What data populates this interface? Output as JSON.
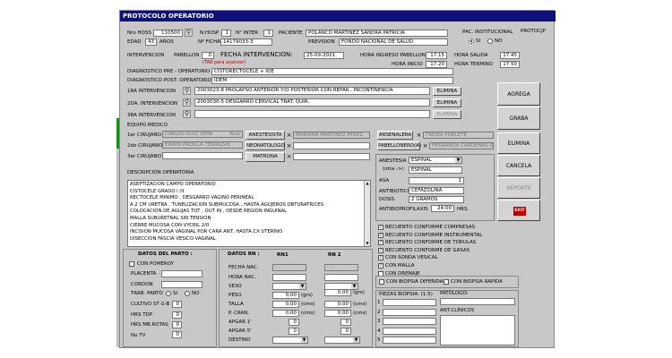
{
  "window": {
    "title": "PROTOCOLO OPERATORIO"
  },
  "header": {
    "nro_hoss_label": "Nro HOSS",
    "nro_hoss": "110500",
    "n_hosp_label": "N.HOSP",
    "n_hosp": "1",
    "n_inter_label": "N° INTER",
    "n_inter": "1",
    "paciente_label": "PACIENTE",
    "paciente": "POLANCO MARTINEZ SANDRA PATRICIA",
    "pac_inst_label": "PAC. INSTITUCIONAL",
    "protocjp_label": "PROTOCJP",
    "edad_label": "EDAD",
    "edad": "43",
    "anos_label": "AÑOS",
    "ficha_label": "Nº FICHA",
    "ficha": "14179033-3",
    "prevision_label": "PREVISION",
    "prevision": "FONDO NACIONAL DE SALUD",
    "si_label": "SI",
    "no_label": "NO"
  },
  "intervencion": {
    "label": "INTERVENCION",
    "pabellon_label": "PABELLON",
    "pabellon": "0",
    "tab_hint": "(TAB para avanzar)",
    "fecha_label": "FECHA INTERVENCION:",
    "fecha": "25-09-2021",
    "hora_ingreso_label": "HORA INGRESO PABELLON",
    "hora_ingreso": "17.15",
    "hora_salida_label": "HORA SALIDA",
    "hora_salida": "17.45",
    "hora_inicio_label": "HORA INICIO",
    "hora_inicio": "17.20",
    "hora_termino_label": "HORA TERMINO",
    "hora_termino": "17.50",
    "dx_pre_label": "DIAGNOSTICO PRE - OPERATORIO",
    "dx_pre": "CISTORECTOCELE + IOE",
    "dx_post_label": "DIAGNOSTICO POST- OPERATORIO",
    "dx_post": "IDEM",
    "int1_label": "1RA INTERVENCION",
    "int1": "2003023-8  PROLAPSO ANTERIOR Y/O POSTERIOR CON REPAR.. INCONTINENCIA",
    "int2_label": "2DA. INTERVENCION",
    "int2": "2003030-5  DESGARRO CERVICAL TRAT. QUIR.",
    "int3_label": "3RA INTERVENCION",
    "elimina_label": "ELIMINA"
  },
  "equipo": {
    "label": "EQUIPO MEDICO",
    "c1_label": "1er CIRUJANO",
    "c1": "CARLOS RUIZ VERA",
    "c1_code": "Ruiz",
    "c2_label": "2do CIRUJANO",
    "c2": "ERWIN PADILLA TERRAZAS",
    "c3_label": "3er CIRUJANO",
    "anestesista_label": "ANESTESISTA",
    "anestesista": "MARIANA MARTINEZ PEREZ",
    "neonatologo_label": "NEONATOLOGO",
    "matrona_label": "MATRONA",
    "arsenalera_label": "ARSENALERA",
    "arsenalera": "TRESIA POBLETE",
    "pabellonera_label": "PABELLONERO(A)",
    "pabellonera": "FERNANDA CARDENAS GA"
  },
  "buttons": {
    "agrega": "AGREGA",
    "graba": "GRABA",
    "elimina": "ELIMINA",
    "cancela": "CANCELA",
    "reporte": "REPORTE",
    "exit": "EXIT"
  },
  "descripcion": {
    "label": "DESCRIPCIÓN OPERATORIA",
    "lines": [
      "ASEPTIZACION  CAMPO OPERATORIO",
      "CISTOCELE GRADO I /II",
      "RECTOCELE MINIMO , DESGARRO VAGINO PERINEAL",
      "A 2 CM URETRA , TUNELIZACION SUBMUCOSA , HASTA AGUJEROS OBTURATRICES",
      "COLOCACION DE AGUJAS TOT , OUT IN , DESDE REGION INGUINAL",
      "MALLA SUBURETRAL SIN TENSION",
      "CIERRE MUCOSA  CON VYCRIL 2/0",
      "INCISION MUCOSA VAGINAL POR CARA ANT, HASTA CX UTERINO",
      "DISECCION FASCIA  VESICO VAGINAL"
    ]
  },
  "anestesia": {
    "label": "ANESTESIA",
    "otra_label": "(otra ->)",
    "tipo": "ESPINAL",
    "tipo2": "ESPINAL",
    "asa_label": "ASA",
    "asa": "1",
    "antibiotico_label": "ANTIBIOTICO",
    "antibiotico": "CEFAZOLINA",
    "dosis_label": "DOSIS",
    "dosis": "2 GRAMOS",
    "profilaxis_label": "ANTIBIOPROFILAXIS",
    "profilaxis": "24:00",
    "hrs_label": "HRS."
  },
  "checks": [
    {
      "label": "RECUENTO CONFORME COMPRESAS",
      "checked": true
    },
    {
      "label": "RECUENTO CONFORME INSTRUMENTAL",
      "checked": true
    },
    {
      "label": "RECUENTO CONFORME DE TORULAS",
      "checked": true
    },
    {
      "label": "RECUENTO CONFORME DE GASAS",
      "checked": true
    },
    {
      "label": "CON SONDA VESICAL",
      "checked": true
    },
    {
      "label": "CON MALLA",
      "checked": true
    },
    {
      "label": "CON DRENAJE",
      "checked": false
    }
  ],
  "parto": {
    "label": "DATOS DEL PARTO :",
    "pomeroy": "CON POMEROY",
    "placenta": "PLACENTA",
    "cordon": "CORDON",
    "trab_parto": "TRAB. PARTO",
    "si": "SI",
    "no": "NO",
    "cultivo": "CULTIVO ST G-B",
    "hrs_tdp": "HRS TDP",
    "hrs_mb": "HRS MB.ROTAS",
    "no_tv": "No TV",
    "cultivo_val": "0",
    "hrs_tdp_val": "0",
    "hrs_mb_val": "0",
    "no_tv_val": "0"
  },
  "rn": {
    "label": "DATOS RN :",
    "rn1": "RN1",
    "rn2": "RN 2",
    "fields": [
      "FECHA NAC.",
      "HORA NAC.",
      "SEXO",
      "PESO",
      "TALLA",
      "P. CRAN.",
      "APGAR 1'",
      "APGAR 5'",
      "DESTINO"
    ],
    "date_ph": "-  -",
    "peso1": "0,00",
    "peso2": "0,00",
    "talla1": "0,00",
    "talla2": "0,00",
    "pcran1": "0,00",
    "pcran2": "0,00",
    "apgar1_1": "0",
    "apgar5_1": "0",
    "apgar1_2": "0",
    "apgar5_2": "0",
    "grs": "(grs)",
    "cms": "(cms)"
  },
  "biopsia": {
    "diferida": "CON BIOPSIA DIFERIDA",
    "rapida": "CON BIOPSIA RAPIDA",
    "piezas_label": "PIEZAS BIOPSIA: (1-5)",
    "patologo_label": "PATÓLOGO:",
    "ant_label": "ANT.CLÍNICOS",
    "nums": [
      "1",
      "2",
      "3",
      "4",
      "5"
    ]
  }
}
